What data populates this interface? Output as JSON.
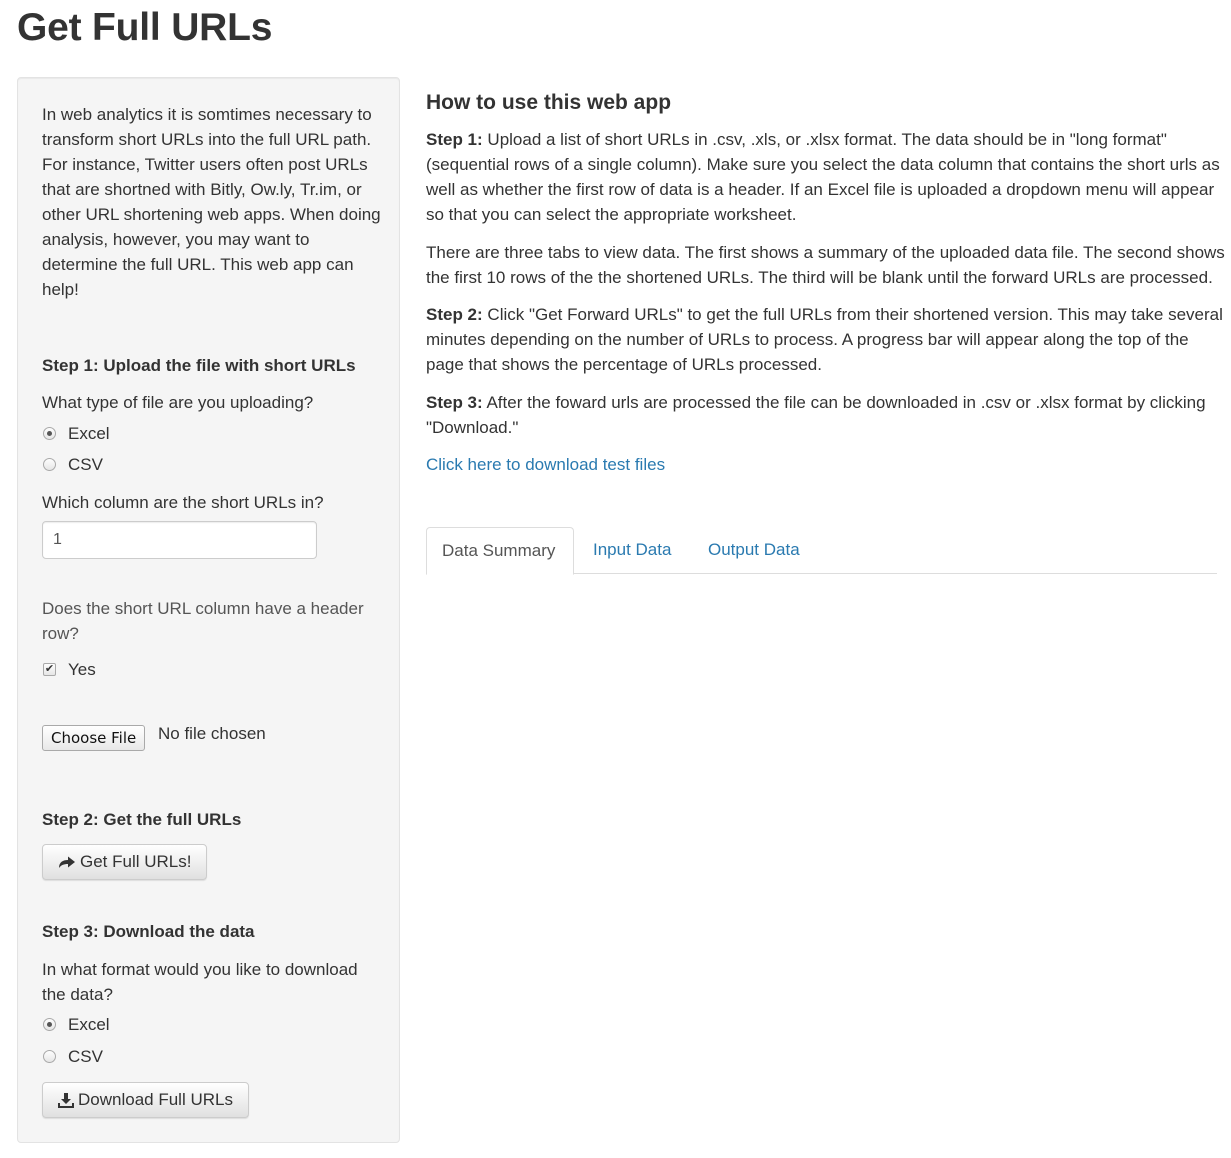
{
  "page": {
    "title": "Get Full URLs"
  },
  "sidebar": {
    "intro": "In web analytics it is somtimes necessary to transform short URLs into the full URL path. For instance, Twitter users often post URLs that are shortned with Bitly, Ow.ly, Tr.im, or other URL shortening web apps. When doing analysis, however, you may want to determine the full URL. This web app can help!",
    "step1": {
      "heading": "Step 1: Upload the file with short URLs",
      "file_type_label": "What type of file are you uploading?",
      "file_type_options": [
        "Excel",
        "CSV"
      ],
      "file_type_selected": "Excel",
      "column_label": "Which column are the short URLs in?",
      "column_value": "1",
      "header_label": "Does the short URL column have a header row?",
      "header_option": "Yes",
      "header_checked": true,
      "file_button": "Choose File",
      "file_status": "No file chosen"
    },
    "step2": {
      "heading": "Step 2: Get the full URLs",
      "button": "Get Full URLs!"
    },
    "step3": {
      "heading": "Step 3: Download the data",
      "format_label": "In what format would you like to download the data?",
      "format_options": [
        "Excel",
        "CSV"
      ],
      "format_selected": "Excel",
      "button": "Download Full URLs"
    }
  },
  "main": {
    "heading": "How to use this web app",
    "p1_lead": "Step 1:",
    "p1_text": " Upload a list of short URLs in .csv, .xls, or .xlsx format. The data should be in \"long format\" (sequential rows of a single column). Make sure you select the data column that contains the short urls as well as whether the first row of data is a header. If an Excel file is uploaded a dropdown menu will appear so that you can select the appropriate worksheet.",
    "p2_text": "There are three tabs to view data. The first shows a summary of the uploaded data file. The second shows the first 10 rows of the the shortened URLs. The third will be blank until the forward URLs are processed.",
    "p3_lead": "Step 2:",
    "p3_text": " Click \"Get Forward URLs\" to get the full URLs from their shortened version. This may take several minutes depending on the number of URLs to process. A progress bar will appear along the top of the page that shows the percentage of URLs processed.",
    "p4_lead": "Step 3:",
    "p4_text": " After the foward urls are processed the file can be downloaded in .csv or .xlsx format by clicking \"Download.\"",
    "link": "Click here to download test files",
    "tabs": [
      {
        "label": "Data Summary",
        "active": true
      },
      {
        "label": "Input Data",
        "active": false
      },
      {
        "label": "Output Data",
        "active": false
      }
    ]
  },
  "icons": {
    "get_urls_button_icon": "share-arrow-icon",
    "download_button_icon": "download-icon"
  }
}
